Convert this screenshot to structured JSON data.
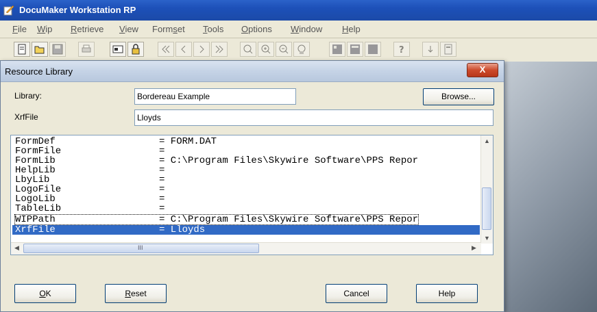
{
  "app": {
    "title": "DocuMaker Workstation RP"
  },
  "menu": [
    {
      "label": "File",
      "u": "F",
      "rest": "ile"
    },
    {
      "label": "Wip",
      "u": "W",
      "rest": "ip"
    },
    {
      "label": "Retrieve",
      "u": "R",
      "rest": "etrieve"
    },
    {
      "label": "View",
      "u": "V",
      "rest": "iew"
    },
    {
      "label": "Formset",
      "pre": "Form",
      "u": "s",
      "rest": "et"
    },
    {
      "label": "Tools",
      "u": "T",
      "rest": "ools"
    },
    {
      "label": "Options",
      "u": "O",
      "rest": "ptions"
    },
    {
      "label": "Window",
      "u": "W",
      "rest": "indow"
    },
    {
      "label": "Help",
      "u": "H",
      "rest": "elp"
    }
  ],
  "toolbar": {
    "icons": [
      "new-icon",
      "open-icon",
      "save-icon",
      "print-icon",
      "card-icon",
      "lock-icon",
      "first-icon",
      "prev-icon",
      "next-icon",
      "last-icon",
      "zoom-icon",
      "zoom-in-icon",
      "zoom-out-icon",
      "preview-icon",
      "page-view-icon",
      "layout-icon",
      "fill-icon",
      "help-icon",
      "down-icon",
      "form-icon"
    ]
  },
  "dialog": {
    "title": "Resource Library",
    "close_glyph": "X",
    "library_label": "Library:",
    "library_value": "Bordereau Example",
    "browse_label": "Browse...",
    "xrffile_label": "XrfFile",
    "xrffile_value": "Lloyds",
    "hscroll_grip": "III",
    "rows": [
      {
        "key": "FormDef",
        "value": "= FORM.DAT"
      },
      {
        "key": "FormFile",
        "value": "="
      },
      {
        "key": "FormLib",
        "value": "= C:\\Program Files\\Skywire Software\\PPS Repor"
      },
      {
        "key": "HelpLib",
        "value": "="
      },
      {
        "key": "LbyLib",
        "value": "="
      },
      {
        "key": "LogoFile",
        "value": "="
      },
      {
        "key": "LogoLib",
        "value": "="
      },
      {
        "key": "TableLib",
        "value": "="
      },
      {
        "key": "WIPPath",
        "value": "= C:\\Program Files\\Skywire Software\\PPS Repor"
      },
      {
        "key": "XrfFile",
        "value": "= Lloyds"
      }
    ],
    "buttons": {
      "ok_u": "O",
      "ok_rest": "K",
      "reset_u": "R",
      "reset_rest": "eset",
      "cancel": "Cancel",
      "help": "Help"
    }
  },
  "colors": {
    "selection": "#316ac5",
    "titlebar": "#2b62c9"
  }
}
